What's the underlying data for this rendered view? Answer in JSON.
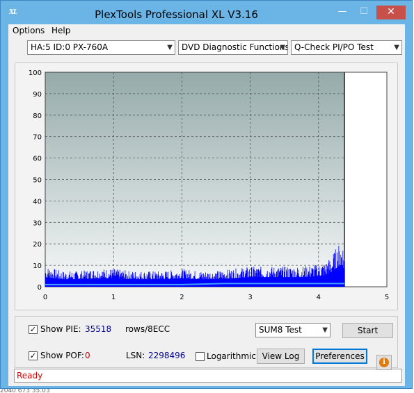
{
  "window": {
    "title": "PlexTools Professional XL V3.16",
    "icon_text": "XL"
  },
  "window_controls": {
    "minimize": "—",
    "maximize": "☐",
    "close": "✕"
  },
  "menu": [
    "Options",
    "Help"
  ],
  "combos": {
    "drive": "HA:5 ID:0  PX-760A",
    "function": "DVD Diagnostic Functions",
    "test": "Q-Check PI/PO Test",
    "mode": "SUM8 Test"
  },
  "chart_data": {
    "type": "area",
    "title": "",
    "xlabel": "",
    "ylabel": "",
    "xlim": [
      0,
      5
    ],
    "ylim": [
      0,
      100
    ],
    "x_ticks": [
      "0",
      "1",
      "2",
      "3",
      "4",
      "5"
    ],
    "y_ticks": [
      "0",
      "10",
      "20",
      "30",
      "40",
      "50",
      "60",
      "70",
      "80",
      "90",
      "100"
    ],
    "grid": true,
    "end_marker_x": 4.38,
    "series": [
      {
        "color": "#0000ff",
        "x": [
          0.0,
          0.25,
          0.5,
          0.75,
          1.0,
          1.25,
          1.5,
          1.75,
          2.0,
          2.25,
          2.5,
          2.75,
          3.0,
          3.25,
          3.5,
          3.75,
          4.0,
          4.1,
          4.2,
          4.25,
          4.3,
          4.35,
          4.38
        ],
        "y": [
          9,
          7,
          7,
          8,
          8,
          7,
          7,
          7,
          8,
          7,
          7,
          8,
          9,
          9,
          9,
          9,
          10,
          11,
          14,
          17,
          19,
          20,
          16
        ]
      },
      {
        "color": "#40a0ff",
        "x": [
          0.0,
          1.0,
          2.0,
          2.6,
          3.0,
          4.0,
          4.38
        ],
        "y": [
          1,
          1,
          1,
          1.5,
          1.5,
          1.5,
          1.5
        ]
      }
    ]
  },
  "bottom": {
    "show_pie_label": "Show PIE:",
    "pie_value": "35518",
    "pie_unit": "rows/8ECC",
    "show_pof_label": "Show POF:",
    "pof_value": "0",
    "lsn_label": "LSN:",
    "lsn_value": "2298496",
    "log_label": "Logarithmic",
    "check_mark": "✓"
  },
  "buttons": {
    "start": "Start",
    "view_log": "View Log",
    "preferences": "Preferences",
    "info": "i"
  },
  "status": "Ready",
  "background_text": "2040    673    35.03"
}
